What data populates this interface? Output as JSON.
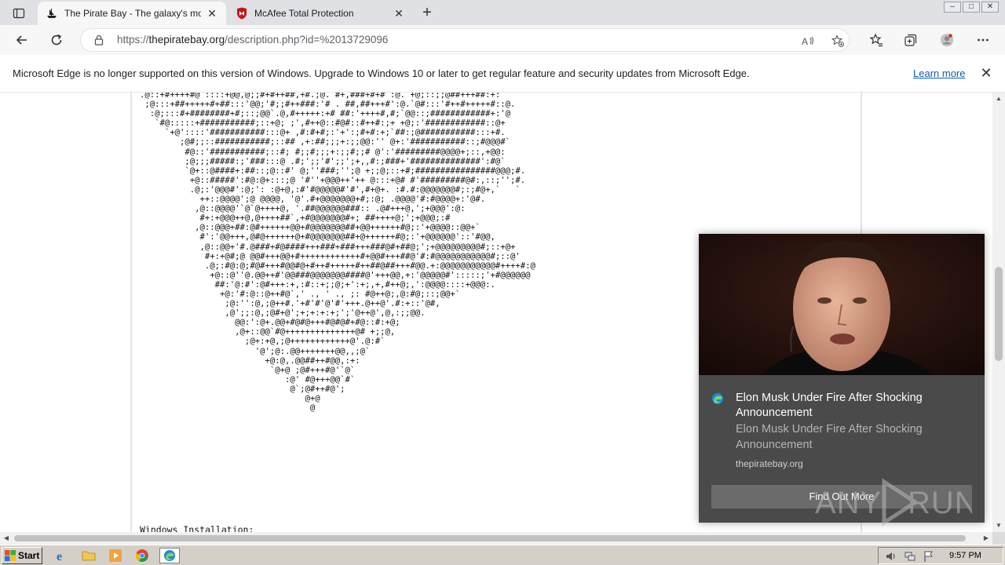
{
  "browser": {
    "tabs": [
      {
        "title": "The Pirate Bay - The galaxy's most resilient BitTorrent site",
        "active": true,
        "icon": "pirate-ship-icon"
      },
      {
        "title": "McAfee Total Protection",
        "active": false,
        "icon": "mcafee-shield-icon"
      }
    ],
    "url_prefix": "https://",
    "url_host": "thepiratebay.org",
    "url_path": "/description.php?id=%2013729096",
    "window_controls": {
      "minimize": "–",
      "maximize": "□",
      "close": "✕"
    }
  },
  "infobar": {
    "message": "Microsoft Edge is no longer supported on this version of Windows. Upgrade to Windows 10 or later to get regular feature and security updates from Microsoft Edge.",
    "learn_more": "Learn more",
    "close": "✕"
  },
  "page": {
    "ascii_art": ".@::+#++++#@ ::::+@@,@;;#+#++##,+#.;@. #+,###+#+# :@. +@;::;;@##+++##:+:\n ;@:::+##+++++#+##:::'@@;'#;;#++###:'# . ##,##+++#':@.`@#:::'#++#+++++#::@.\n  :@;:::#+########+#;::;@@`.@,#+++++:+# ##:'++++#,#;`@@::;############+:'@\n   `#@:::::+###########;::+@; ;',#++@::#@#::#++#:;+ +@;:'############::@+\n     `+@'::::'###########:::@+ ,#:#+#;:'+':;#+#:+;`##:;@###########:::+#.\n        ;@#;;::###########;::## ,+:##;;;+:;;@@:'' @+:'###########::;#@@@#`\n         #@::'###########;::#; #;;#;;;+:;;#;;# @':'#########@@@@+;::,+@@:\n         ;@;;;#####:;'###:::@ .#;';;'#';;';+,,#:;###+'##############':#@`\n         `@+::@####+:##::;@::#' @;''###;'';@ +;;@;::+#;################@@@;#.\n          +@::#####':#@:@+:::;@ '#''+@@@++'++ @:::+@# #'#########@#:,::;'';#.\n          .@;:'@@@#':@;': :@+@,:#'#@@@@@#'#',#+@+. :#.#:@@@@@@@#;:;#@+,`   `\n            ++::@@@@';@ @@@@, '@'.#+@@@@@@@+#;:@; .@@@@'#:#@@@@+:'@#.\n           ,@::@@@@'`@`@++++@, '.##@@@@@@###:: .@#+++@,';+@@@':@:\n            #+:+@@@++@,@++++##`,+#@@@@@@@#+; ##++++@;';+@@@;:#\n           ,@::@@@+##:@#++++++@@+#@@@@@@@##+@@++++++#@;:'+@@@@::@@+`\n            #':'@@+++,@#@++++++@+#@@@@@@@##+@++++++#@;:'+@@@@@@'::'#@@,\n            ,@::@@+'#.@###+#@####+++###+###+++###@#+##@;';+@@@@@@@@@#;::+@+\n             #+:+@#;@ @@#+++@@+#++++++++++++#+@@#+++##@'#:#@@@@@@@@@@@#;::@'\n             .@;:#@:@;#@#+++#@@#@+#++#+++++#++##@##+++#@@.+:@@@@@@@@@@@#++++#:@\n              +@::@''@.@@++#'@@###@@@@@@@####@'+++@@,+:'@@@@@#':::::;'+#@@@@@@\n               ##:'@:#':@#+++:+,:#::+;;@;+':+;,+,#++@;,':@@@@::::+@@@:.\n                +@:'#:@::@++#@`,' ., ' ., ;: #@++@;,@:#@;::;@@+`\n                 ;@:'':@,;@++#.'+#'#'@'#'+++.@++@'.#:+::'@#,\n                 ,@';;:@,;@#+@';+;+:+:+;';'@++@',@,:;;@@.\n                   @@:':@+.@@+#@#@+++#@#@#+#@::#:+@;\n                   ,@+::@@`#@++++++++++++++@# +;;@,\n                     ;@+:+@,;@++++++++++++@'.@:#`\n                       '@';@:.@@+++++++@@,,;@`\n                         +@:@,.@@##++#@@,:+:\n                          `@+@ ;@#+++#@'`@`\n                             :@' #@+++@@`#`\n                              @`;@#++#@';\n                                 @+@\n                                  @",
    "section_heading": "Windows Installation:"
  },
  "notification": {
    "title": "Elon Musk Under Fire After Shocking Announcement",
    "body": "Elon Musk Under Fire After Shocking Announcement",
    "source": "thepiratebay.org",
    "button": "Find Out More"
  },
  "watermark": {
    "text": "RUN"
  },
  "taskbar": {
    "start_label": "Start",
    "clock": "9:57 PM"
  }
}
